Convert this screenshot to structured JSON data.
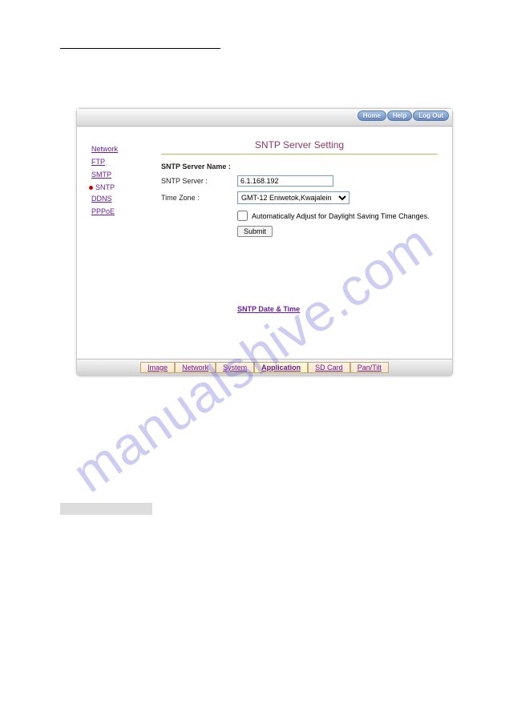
{
  "watermark": "manualshive.com",
  "topButtons": {
    "home": "Home",
    "help": "Help",
    "logout": "Log Out"
  },
  "sidebar": {
    "items": [
      {
        "label": "Network"
      },
      {
        "label": "FTP"
      },
      {
        "label": "SMTP"
      },
      {
        "label": "SNTP"
      },
      {
        "label": "DDNS"
      },
      {
        "label": "PPPoE"
      }
    ]
  },
  "panel": {
    "title": "SNTP Server Setting",
    "serverNameLabel": "SNTP Server Name :",
    "serverLabel": "SNTP Server :",
    "serverValue": "6.1.168.192",
    "timeZoneLabel": "Time Zone :",
    "timeZoneValue": "GMT-12 Eniwetok,Kwajalein",
    "dstLabel": "Automatically Adjust for Daylight Saving Time Changes.",
    "submitLabel": "Submit",
    "bottomLink": "SNTP Date & Time"
  },
  "bottomTabs": {
    "items": [
      {
        "label": "Image"
      },
      {
        "label": "Network"
      },
      {
        "label": "System"
      },
      {
        "label": "Application"
      },
      {
        "label": "SD Card"
      },
      {
        "label": "Pan/Tilt"
      }
    ]
  }
}
